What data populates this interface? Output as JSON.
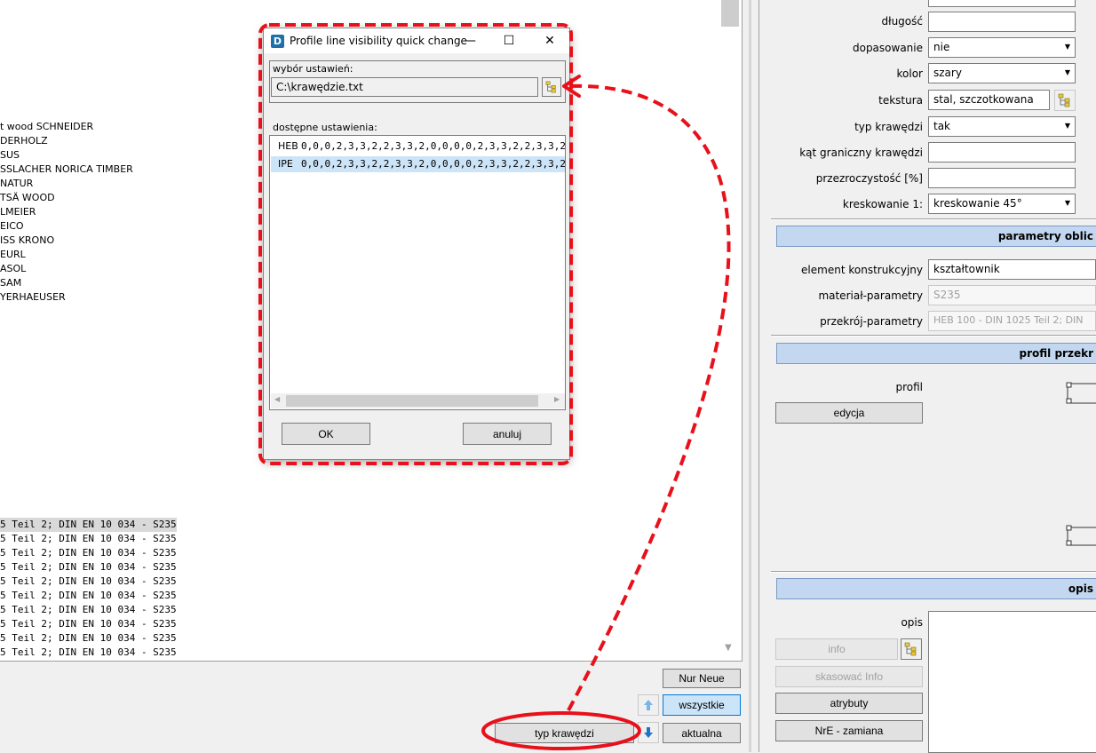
{
  "left_panel": {
    "vendors": [
      "t wood SCHNEIDER",
      "DERHOLZ",
      "SUS",
      "SSLACHER NORICA TIMBER",
      "NATUR",
      "TSÄ WOOD",
      "LMEIER",
      "EICO",
      "ISS KRONO",
      "EURL",
      "ASOL",
      "SAM",
      "YERHAEUSER"
    ],
    "profile_rows": [
      "5 Teil 2; DIN EN 10 034 - S235",
      "5 Teil 2; DIN EN 10 034 - S235",
      "5 Teil 2; DIN EN 10 034 - S235",
      "5 Teil 2; DIN EN 10 034 - S235",
      "5 Teil 2; DIN EN 10 034 - S235",
      "5 Teil 2; DIN EN 10 034 - S235",
      "5 Teil 2; DIN EN 10 034 - S235",
      "5 Teil 2; DIN EN 10 034 - S235",
      "5 Teil 2; DIN EN 10 034 - S235",
      "5 Teil 2; DIN EN 10 034 - S235"
    ],
    "buttons": {
      "nur_neue": "Nur Neue",
      "wszystkie": "wszystkie",
      "typ_krawedzi": "typ krawędzi",
      "aktualna": "aktualna"
    }
  },
  "dialog": {
    "title": "Profile line visibility quick change",
    "logo": "D",
    "controls": {
      "minimize": "—",
      "maximize": "☐",
      "close": "✕"
    },
    "selection_label": "wybór ustawień:",
    "path_value": "C:\\krawędzie.txt",
    "available_label": "dostępne ustawienia:",
    "settings": [
      {
        "name": "HEB",
        "value": "0,0,0,2,3,3,2,2,3,3,2,0,0,0,0,2,3,3,2,2,3,3,2,0,"
      },
      {
        "name": "IPE",
        "value": "0,0,0,2,3,3,2,2,3,3,2,0,0,0,0,2,3,3,2,2,3,3,2,0,0"
      }
    ],
    "scroll_left": "◀",
    "scroll_right": "▶",
    "ok_label": "OK",
    "cancel_label": "anuluj"
  },
  "properties": {
    "dlugosc_label": "długość",
    "dlugosc_value": "",
    "dopasowanie_label": "dopasowanie",
    "dopasowanie_value": "nie",
    "kolor_label": "kolor",
    "kolor_value": "szary",
    "tekstura_label": "tekstura",
    "tekstura_value": "stal, szczotkowana",
    "typ_krawedzi_label": "typ krawędzi",
    "typ_krawedzi_value": "tak",
    "kat_label": "kąt graniczny krawędzi",
    "kat_value": "",
    "przezr_label": "przezroczystość [%]",
    "przezr_value": "",
    "kreskowanie_label": "kreskowanie 1:",
    "kreskowanie_value": "kreskowanie 45°"
  },
  "calc_params": {
    "header": "parametry oblic",
    "element_label": "element konstrukcyjny",
    "element_value": "kształtownik",
    "material_label": "materiał-parametry",
    "material_value": "S235",
    "przekroj_label": "przekrój-parametry",
    "przekroj_value": "HEB 100 - DIN 1025 Teil 2; DIN"
  },
  "profile_section": {
    "header": "profil przekr",
    "profil_label": "profil",
    "edit_button": "edycja"
  },
  "description": {
    "header": "opis",
    "opis_label": "opis",
    "info_button": "info",
    "delete_info_button": "skasować Info",
    "attributes_button": "atrybuty",
    "nre_button": "NrE - zamiana"
  },
  "colors": {
    "annotation_red": "#e8101a",
    "section_header": "#c3d8f0",
    "selection_blue": "#cce4f7"
  }
}
